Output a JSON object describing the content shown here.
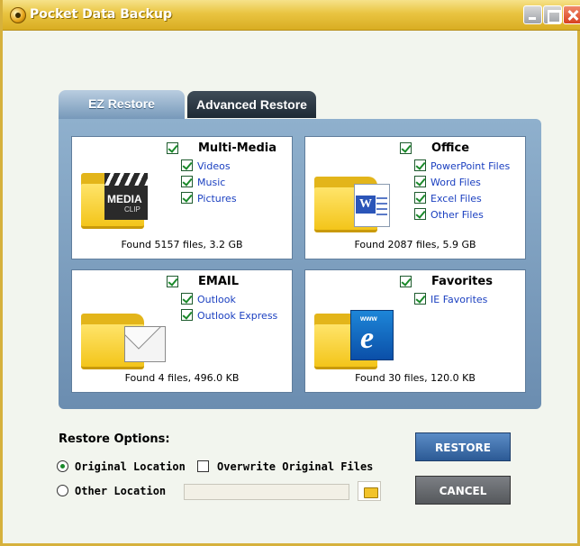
{
  "window": {
    "title": "Pocket Data Backup"
  },
  "tabs": [
    {
      "label": "EZ Restore",
      "active": true
    },
    {
      "label": "Advanced Restore",
      "active": false
    }
  ],
  "categories": {
    "multimedia": {
      "title": "Multi-Media",
      "items": [
        "Videos",
        "Music",
        "Pictures"
      ],
      "found": "Found 5157 files, 3.2 GB",
      "icon_text": [
        "MEDIA",
        "CLIP"
      ]
    },
    "office": {
      "title": "Office",
      "items": [
        "PowerPoint Files",
        "Word Files",
        "Excel Files",
        "Other Files"
      ],
      "found": "Found 2087 files, 5.9 GB"
    },
    "email": {
      "title": "EMAIL",
      "items": [
        "Outlook",
        "Outlook Express"
      ],
      "found": "Found 4 files, 496.0 KB"
    },
    "favorites": {
      "title": "Favorites",
      "items": [
        "IE Favorites"
      ],
      "found": "Found 30 files, 120.0 KB",
      "icon_text": "www"
    }
  },
  "restore_options": {
    "title": "Restore Options:",
    "original_location": "Original Location",
    "other_location": "Other Location",
    "overwrite": "Overwrite Original Files",
    "path_value": ""
  },
  "buttons": {
    "restore": "RESTORE",
    "cancel": "CANCEL"
  },
  "colors": {
    "title_bar": "#e9c441",
    "panel": "#7b9cbf",
    "item_link": "#1a3fc0",
    "restore_btn": "#2c5a95",
    "cancel_btn": "#55585c"
  }
}
